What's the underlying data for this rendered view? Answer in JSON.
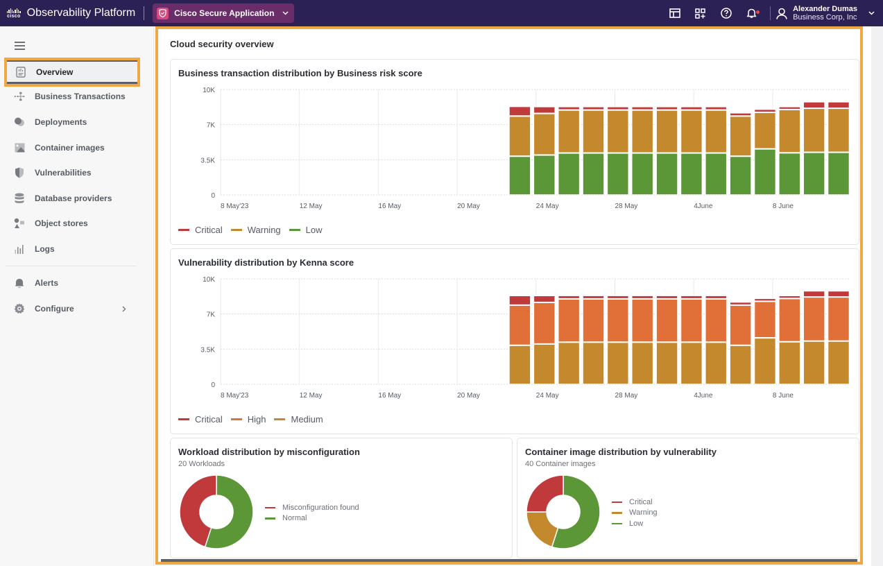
{
  "topbar": {
    "brand_logo": "cisco",
    "app_title": "Observability Platform",
    "app_switcher": {
      "label": "Cisco Secure Application",
      "icon": "shield-icon"
    },
    "tools": [
      {
        "name": "layout-icon"
      },
      {
        "name": "add-widget-icon"
      },
      {
        "name": "help-icon"
      },
      {
        "name": "notifications-bell-icon",
        "has_unread": true
      }
    ],
    "user": {
      "name": "Alexander Dumas",
      "org": "Business Corp, Inc"
    }
  },
  "sidebar": {
    "items": [
      {
        "label": "Overview",
        "icon": "overview-icon",
        "active": true
      },
      {
        "label": "Business Transactions",
        "icon": "business-transactions-icon"
      },
      {
        "label": "Deployments",
        "icon": "deployments-icon"
      },
      {
        "label": "Container images",
        "icon": "container-images-icon"
      },
      {
        "label": "Vulnerabilities",
        "icon": "vulnerabilities-icon"
      },
      {
        "label": "Database providers",
        "icon": "database-icon"
      },
      {
        "label": "Object stores",
        "icon": "object-stores-icon"
      },
      {
        "label": "Logs",
        "icon": "logs-icon"
      }
    ],
    "bottom_items": [
      {
        "label": "Alerts",
        "icon": "bell-icon"
      },
      {
        "label": "Configure",
        "icon": "gear-icon",
        "has_submenu": true
      }
    ]
  },
  "main": {
    "title": "Cloud security overview"
  },
  "colors": {
    "critical": "#c0393b",
    "warning": "#c4882d",
    "low": "#5b9637",
    "high": "#e06f38",
    "medium": "#c4882d",
    "highlight": "#efa944",
    "topbar": "#2b2154"
  },
  "chart_data": [
    {
      "type": "bar",
      "stacked": true,
      "title": "Business transaction distribution by Business risk score",
      "xlabel": "",
      "ylabel": "",
      "ylim": [
        0,
        10500
      ],
      "y_ticks": [
        {
          "v": 0,
          "label": "0"
        },
        {
          "v": 3500,
          "label": "3.5K"
        },
        {
          "v": 7000,
          "label": "7K"
        },
        {
          "v": 10500,
          "label": "10K"
        }
      ],
      "x_tick_labels": [
        "8 May'23",
        "12 May",
        "16 May",
        "20 May",
        "24 May",
        "28 May",
        "4June",
        "8 June"
      ],
      "bar_count": 14,
      "grid": true,
      "legend_position": "bottom-left",
      "series": [
        {
          "name": "Low",
          "color": "#5b9637",
          "values": [
            3870,
            3990,
            4190,
            4190,
            4190,
            4190,
            4190,
            4190,
            4190,
            3870,
            4600,
            4210,
            4260,
            4260
          ]
        },
        {
          "name": "Warning",
          "color": "#c4882d",
          "values": [
            4000,
            4140,
            4280,
            4280,
            4280,
            4280,
            4280,
            4280,
            4280,
            4000,
            3640,
            4310,
            4390,
            4390
          ]
        },
        {
          "name": "Critical",
          "color": "#c0393b",
          "values": [
            970,
            690,
            350,
            350,
            350,
            350,
            350,
            350,
            350,
            330,
            320,
            300,
            650,
            650
          ]
        }
      ],
      "legend": [
        "Critical",
        "Warning",
        "Low"
      ]
    },
    {
      "type": "bar",
      "stacked": true,
      "title": "Vulnerability distribution by Kenna score",
      "xlabel": "",
      "ylabel": "",
      "ylim": [
        0,
        10500
      ],
      "y_ticks": [
        {
          "v": 0,
          "label": "0"
        },
        {
          "v": 3500,
          "label": "3.5K"
        },
        {
          "v": 7000,
          "label": "7K"
        },
        {
          "v": 10500,
          "label": "10K"
        }
      ],
      "x_tick_labels": [
        "8 May'23",
        "12 May",
        "16 May",
        "20 May",
        "24 May",
        "28 May",
        "4June",
        "8 June"
      ],
      "bar_count": 14,
      "grid": true,
      "legend_position": "bottom-left",
      "series": [
        {
          "name": "Medium",
          "color": "#c4882d",
          "values": [
            3900,
            4030,
            4210,
            4210,
            4210,
            4210,
            4210,
            4210,
            4210,
            3900,
            4640,
            4250,
            4320,
            4320
          ]
        },
        {
          "name": "High",
          "color": "#e06f38",
          "values": [
            4000,
            4140,
            4310,
            4310,
            4310,
            4310,
            4310,
            4310,
            4310,
            4000,
            3640,
            4310,
            4390,
            4390
          ]
        },
        {
          "name": "Critical",
          "color": "#c0393b",
          "values": [
            960,
            690,
            350,
            350,
            350,
            350,
            350,
            350,
            350,
            320,
            300,
            300,
            620,
            620
          ]
        }
      ],
      "legend": [
        "Critical",
        "High",
        "Medium"
      ]
    },
    {
      "type": "pie",
      "donut": true,
      "title": "Workload distribution by misconfiguration",
      "subtitle": "20 Workloads",
      "legend_position": "right",
      "slices": [
        {
          "name": "Normal",
          "value": 11,
          "color": "#5b9637"
        },
        {
          "name": "Misconfiguration found",
          "value": 9,
          "color": "#c0393b"
        }
      ],
      "legend": [
        {
          "name": "Misconfiguration found",
          "color": "#c0393b"
        },
        {
          "name": "Normal",
          "color": "#5b9637"
        }
      ]
    },
    {
      "type": "pie",
      "donut": true,
      "title": "Container image distribution by vulnerability",
      "subtitle": "40 Container images",
      "legend_position": "right",
      "slices": [
        {
          "name": "Low",
          "value": 22,
          "color": "#5b9637"
        },
        {
          "name": "Warning",
          "value": 8,
          "color": "#c4882d"
        },
        {
          "name": "Critical",
          "value": 10,
          "color": "#c0393b"
        }
      ],
      "legend": [
        {
          "name": "Critical",
          "color": "#c0393b"
        },
        {
          "name": "Warning",
          "color": "#c4882d"
        },
        {
          "name": "Low",
          "color": "#5b9637"
        }
      ]
    }
  ]
}
